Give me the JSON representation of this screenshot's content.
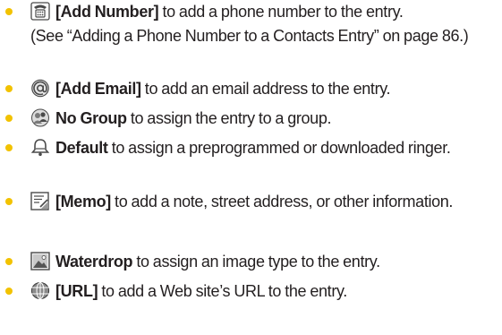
{
  "colors": {
    "bullet": "#f2c200",
    "text": "#231f20",
    "icon": "#4a4a4a"
  },
  "items": [
    {
      "icon": "phone-icon",
      "label": "[Add Number]",
      "desc": " to add a phone number to the entry.",
      "sub": "(See “Adding a Phone Number to a Contacts Entry” on page 86.)"
    },
    {
      "icon": "email-at-icon",
      "label": "[Add Email]",
      "desc": " to add an email address to the entry."
    },
    {
      "icon": "group-icon",
      "label": "No Group",
      "desc": " to assign the entry to a group."
    },
    {
      "icon": "ringer-bell-icon",
      "label": "Default",
      "desc": " to assign a preprogrammed or downloaded ringer."
    },
    {
      "icon": "memo-icon",
      "label": "[Memo]",
      "desc": " to add a note, street address, or other information."
    },
    {
      "icon": "picture-icon",
      "label": "Waterdrop",
      "desc": " to assign an image type to the entry."
    },
    {
      "icon": "web-globe-icon",
      "label": "[URL]",
      "desc": " to add a Web site’s URL to the entry."
    }
  ]
}
